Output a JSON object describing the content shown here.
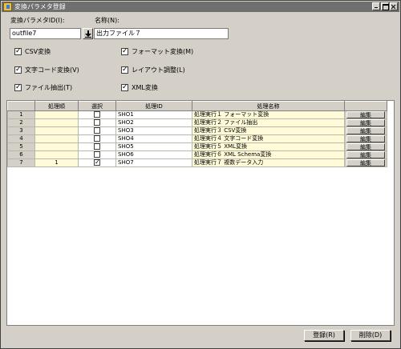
{
  "window": {
    "title": "変換パラメタ登録"
  },
  "form": {
    "param_id_label": "変換パラメタID(I):",
    "param_id_value": "outfile7",
    "name_label": "名称(N):",
    "name_value": "出力ファイル７"
  },
  "options": [
    {
      "label": "CSV変換",
      "checked": true
    },
    {
      "label": "フォーマット変換(M)",
      "checked": true
    },
    {
      "label": "文字コード変換(V)",
      "checked": true
    },
    {
      "label": "レイアウト調整(L)",
      "checked": true
    },
    {
      "label": "ファイル抽出(T)",
      "checked": true
    },
    {
      "label": "XML変換",
      "checked": true
    }
  ],
  "table": {
    "headers": [
      "",
      "処理順",
      "選択",
      "処理ID",
      "処理名称",
      ""
    ],
    "edit_label": "編集",
    "rows": [
      {
        "num": "1",
        "order": "",
        "selected": false,
        "id": "SHO1",
        "name": "処理実行１ フォーマット変換"
      },
      {
        "num": "2",
        "order": "",
        "selected": false,
        "id": "SHO2",
        "name": "処理実行２ ファイル抽出"
      },
      {
        "num": "3",
        "order": "",
        "selected": false,
        "id": "SHO3",
        "name": "処理実行３ CSV変換"
      },
      {
        "num": "4",
        "order": "",
        "selected": false,
        "id": "SHO4",
        "name": "処理実行４ 文字コード変換"
      },
      {
        "num": "5",
        "order": "",
        "selected": false,
        "id": "SHO5",
        "name": "処理実行５ XML変換"
      },
      {
        "num": "6",
        "order": "",
        "selected": false,
        "id": "SHO6",
        "name": "処理実行６ XML Schema変換"
      },
      {
        "num": "7",
        "order": "1",
        "selected": true,
        "id": "SHO7",
        "name": "処理実行７ 複数データ入力"
      }
    ]
  },
  "buttons": {
    "register": "登録(R)",
    "delete": "削除(D)"
  }
}
